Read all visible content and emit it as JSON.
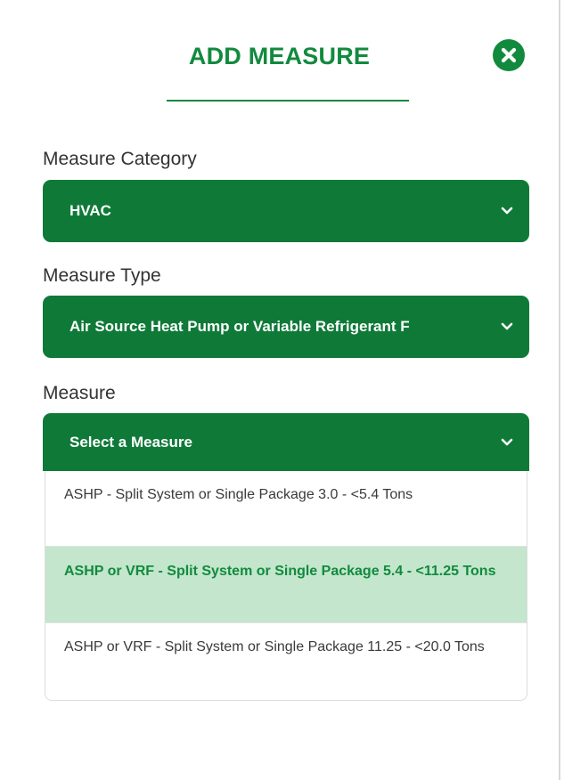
{
  "modal": {
    "title": "ADD MEASURE",
    "close_icon": "close-circle-icon"
  },
  "fields": {
    "category": {
      "label": "Measure Category",
      "value": "HVAC"
    },
    "type": {
      "label": "Measure Type",
      "value": "Air Source Heat Pump or Variable Refrigerant F"
    },
    "measure": {
      "label": "Measure",
      "placeholder": "Select a Measure",
      "options": [
        {
          "label": "ASHP - Split System or Single Package 3.0 - <5.4 Tons",
          "selected": false
        },
        {
          "label": "ASHP or VRF - Split System or Single Package 5.4 - <11.25 Tons",
          "selected": true
        },
        {
          "label": "ASHP or VRF - Split System or Single Package 11.25 - <20.0 Tons",
          "selected": false
        }
      ]
    }
  },
  "colors": {
    "brand_green": "#128a3e",
    "select_bg": "#0f7a38",
    "option_highlight": "#c3e6cc"
  }
}
